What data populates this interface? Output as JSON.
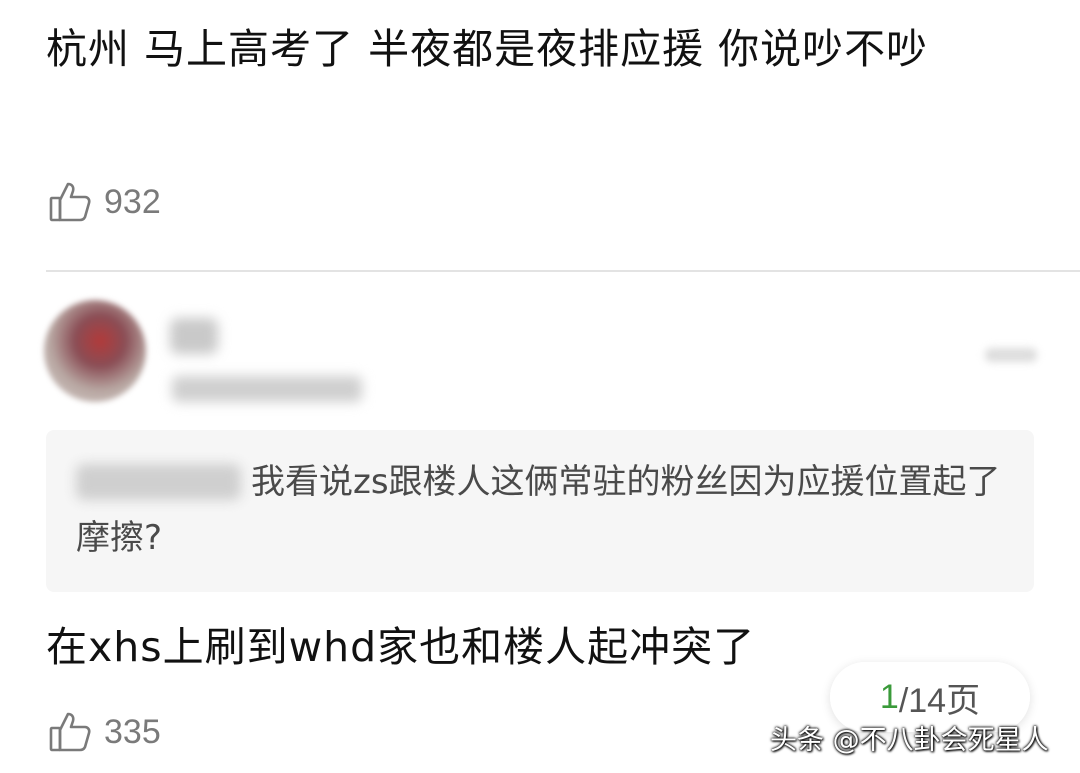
{
  "post": {
    "text": "杭州 马上高考了 半夜都是夜排应援 你说吵不吵",
    "likes": "932"
  },
  "comment": {
    "quote_text": "我看说zs跟楼人这俩常驻的粉丝因为应援位置起了摩擦?",
    "reply_text": "在xhs上刷到whd家也和楼人起冲突了",
    "likes": "335"
  },
  "pager": {
    "current": "1",
    "total": "/14页"
  },
  "watermark": "头条 @不八卦会死星人",
  "icons": {
    "like": "thumbs-up-icon"
  },
  "colors": {
    "accent": "#3a9a3a",
    "muted": "#7a7a7a"
  }
}
